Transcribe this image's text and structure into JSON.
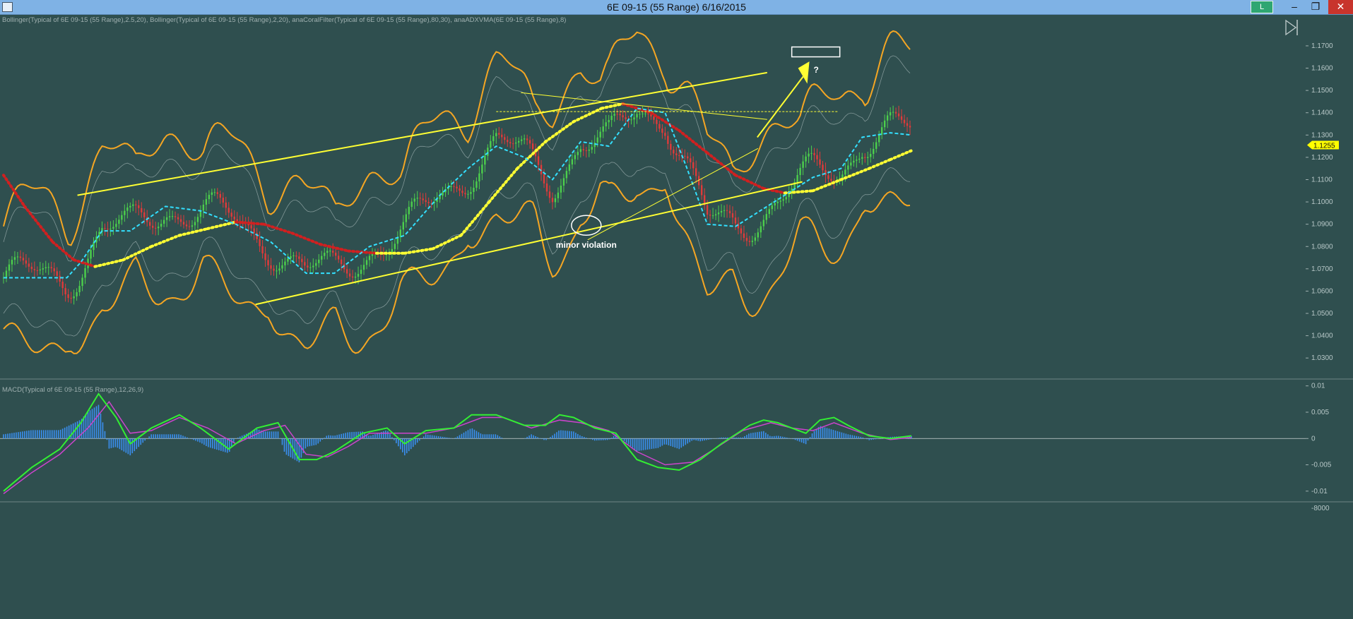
{
  "window": {
    "title": "6E 09-15 (55 Range)  6/16/2015",
    "badge": "L",
    "minimize_icon": "minimize-icon",
    "maximize_icon": "restore-icon",
    "close_icon": "close-icon"
  },
  "chart_data": [
    {
      "type": "candlestick",
      "indicator_label": "Bollinger(Typical of 6E 09-15 (55 Range),2.5,20), Bollinger(Typical of 6E 09-15 (55 Range),2,20), anaCoralFilter(Typical of 6E 09-15 (55 Range),80,30), anaADXVMA(6E 09-15 (55 Range),8)",
      "y_ticks": [
        "1.1700",
        "1.1600",
        "1.1500",
        "1.1400",
        "1.1300",
        "1.1200",
        "1.1100",
        "1.1000",
        "1.0900",
        "1.0800",
        "1.0700",
        "1.0600",
        "1.0500",
        "1.0400",
        "1.0300"
      ],
      "ylim": [
        1.025,
        1.176
      ],
      "last_price": "1.1255",
      "annotations": {
        "minor_violation": "minor violation",
        "question": "?"
      },
      "colors": {
        "background": "#2f4f4f",
        "bollinger_outer": "#f5a623",
        "bollinger_inner": "#b7c7c7",
        "trendline": "#ffff33",
        "coral_up": "#ffff33",
        "coral_down": "#d02020",
        "adxvma": "#33e0ff",
        "candle_up": "#4ccf4c",
        "candle_down": "#e03a3a",
        "price_label_bg": "#ffff00"
      },
      "series": [
        {
          "name": "coral_filter",
          "points": [
            [
              0,
              1.112
            ],
            [
              30,
              1.098
            ],
            [
              70,
              1.082
            ],
            [
              100,
              1.074
            ],
            [
              130,
              1.071
            ],
            [
              170,
              1.074
            ],
            [
              210,
              1.08
            ],
            [
              250,
              1.085
            ],
            [
              290,
              1.088
            ],
            [
              330,
              1.091
            ],
            [
              370,
              1.09
            ],
            [
              410,
              1.086
            ],
            [
              450,
              1.081
            ],
            [
              490,
              1.078
            ],
            [
              530,
              1.077
            ],
            [
              570,
              1.077
            ],
            [
              610,
              1.079
            ],
            [
              650,
              1.085
            ],
            [
              690,
              1.1
            ],
            [
              730,
              1.115
            ],
            [
              770,
              1.127
            ],
            [
              810,
              1.136
            ],
            [
              850,
              1.142
            ],
            [
              880,
              1.144
            ],
            [
              920,
              1.14
            ],
            [
              960,
              1.132
            ],
            [
              1000,
              1.122
            ],
            [
              1040,
              1.112
            ],
            [
              1080,
              1.106
            ],
            [
              1110,
              1.104
            ],
            [
              1150,
              1.105
            ],
            [
              1190,
              1.11
            ],
            [
              1230,
              1.115
            ],
            [
              1260,
              1.119
            ],
            [
              1290,
              1.123
            ]
          ]
        },
        {
          "name": "adxvma",
          "points": [
            [
              0,
              1.066
            ],
            [
              90,
              1.066
            ],
            [
              110,
              1.073
            ],
            [
              140,
              1.087
            ],
            [
              180,
              1.087
            ],
            [
              230,
              1.098
            ],
            [
              280,
              1.096
            ],
            [
              330,
              1.09
            ],
            [
              380,
              1.082
            ],
            [
              430,
              1.068
            ],
            [
              470,
              1.068
            ],
            [
              520,
              1.08
            ],
            [
              570,
              1.085
            ],
            [
              620,
              1.103
            ],
            [
              660,
              1.115
            ],
            [
              700,
              1.125
            ],
            [
              740,
              1.12
            ],
            [
              780,
              1.11
            ],
            [
              820,
              1.127
            ],
            [
              860,
              1.125
            ],
            [
              900,
              1.142
            ],
            [
              940,
              1.14
            ],
            [
              970,
              1.116
            ],
            [
              1000,
              1.09
            ],
            [
              1040,
              1.089
            ],
            [
              1080,
              1.097
            ],
            [
              1110,
              1.103
            ],
            [
              1150,
              1.111
            ],
            [
              1190,
              1.115
            ],
            [
              1220,
              1.129
            ],
            [
              1260,
              1.131
            ],
            [
              1290,
              1.13
            ]
          ]
        }
      ],
      "x_range": [
        0,
        1290
      ],
      "candle_seed": 7
    },
    {
      "type": "line",
      "indicator_label": "MACD(Typical of 6E 09-15 (55 Range),12,26,9)",
      "y_ticks": [
        "0.01",
        "0.005",
        "0",
        "-0.005",
        "-0.01"
      ],
      "partial_tick": "-8000",
      "ylim": [
        -0.0115,
        0.0105
      ],
      "colors": {
        "macd": "#33ee33",
        "signal": "#cc44cc",
        "histogram": "#3a8ff0",
        "zero": "#cfd8d8"
      },
      "series": [
        {
          "name": "macd",
          "points": [
            [
              0,
              -0.01
            ],
            [
              40,
              -0.0055
            ],
            [
              80,
              -0.002
            ],
            [
              110,
              0.003
            ],
            [
              135,
              0.0085
            ],
            [
              160,
              0.004
            ],
            [
              180,
              -0.001
            ],
            [
              210,
              0.002
            ],
            [
              250,
              0.0045
            ],
            [
              280,
              0.002
            ],
            [
              320,
              -0.002
            ],
            [
              360,
              0.002
            ],
            [
              390,
              0.003
            ],
            [
              420,
              -0.004
            ],
            [
              445,
              -0.004
            ],
            [
              470,
              -0.0025
            ],
            [
              510,
              0.001
            ],
            [
              545,
              0.002
            ],
            [
              570,
              -0.001
            ],
            [
              600,
              0.0015
            ],
            [
              640,
              0.002
            ],
            [
              665,
              0.0045
            ],
            [
              700,
              0.0045
            ],
            [
              740,
              0.0025
            ],
            [
              770,
              0.0025
            ],
            [
              790,
              0.0045
            ],
            [
              810,
              0.004
            ],
            [
              840,
              0.002
            ],
            [
              870,
              0.001
            ],
            [
              900,
              -0.004
            ],
            [
              930,
              -0.0055
            ],
            [
              960,
              -0.006
            ],
            [
              990,
              -0.004
            ],
            [
              1020,
              -0.001
            ],
            [
              1060,
              0.0025
            ],
            [
              1080,
              0.0035
            ],
            [
              1100,
              0.003
            ],
            [
              1120,
              0.002
            ],
            [
              1140,
              0.001
            ],
            [
              1160,
              0.0035
            ],
            [
              1180,
              0.004
            ],
            [
              1200,
              0.0025
            ],
            [
              1230,
              0.0005
            ],
            [
              1260,
              0.0
            ],
            [
              1290,
              0.0005
            ]
          ]
        },
        {
          "name": "signal",
          "points": [
            [
              0,
              -0.0105
            ],
            [
              40,
              -0.0065
            ],
            [
              80,
              -0.003
            ],
            [
              120,
              0.002
            ],
            [
              150,
              0.007
            ],
            [
              180,
              0.001
            ],
            [
              210,
              0.0015
            ],
            [
              250,
              0.004
            ],
            [
              290,
              0.002
            ],
            [
              330,
              -0.001
            ],
            [
              370,
              0.0015
            ],
            [
              400,
              0.0025
            ],
            [
              430,
              -0.003
            ],
            [
              460,
              -0.0035
            ],
            [
              490,
              -0.0015
            ],
            [
              520,
              0.001
            ],
            [
              560,
              0.001
            ],
            [
              600,
              0.001
            ],
            [
              640,
              0.002
            ],
            [
              680,
              0.004
            ],
            [
              710,
              0.004
            ],
            [
              750,
              0.002
            ],
            [
              790,
              0.0035
            ],
            [
              820,
              0.003
            ],
            [
              860,
              0.0015
            ],
            [
              900,
              -0.0025
            ],
            [
              940,
              -0.005
            ],
            [
              980,
              -0.0045
            ],
            [
              1010,
              -0.002
            ],
            [
              1050,
              0.0015
            ],
            [
              1090,
              0.003
            ],
            [
              1120,
              0.002
            ],
            [
              1150,
              0.0015
            ],
            [
              1180,
              0.003
            ],
            [
              1220,
              0.001
            ],
            [
              1260,
              -0.0002
            ],
            [
              1290,
              0.0002
            ]
          ]
        }
      ],
      "x_range": [
        0,
        1290
      ]
    }
  ]
}
